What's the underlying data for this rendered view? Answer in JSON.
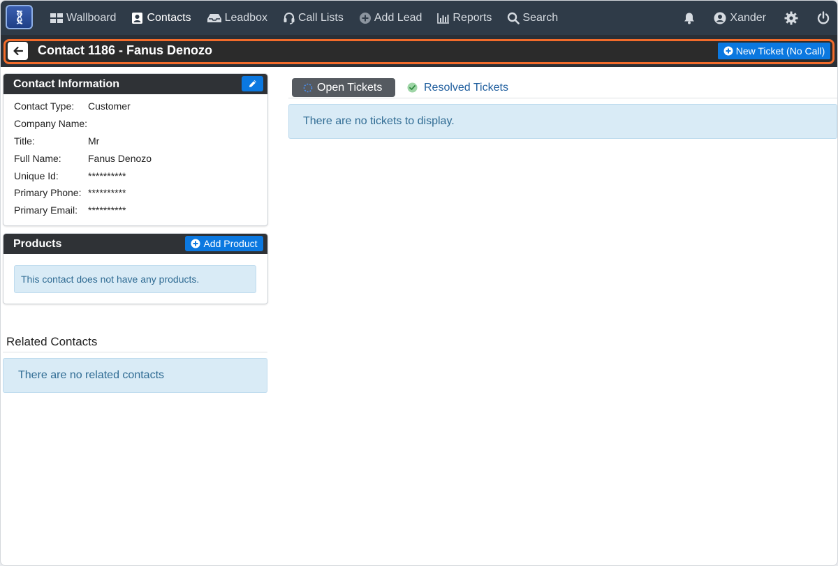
{
  "nav": {
    "items": [
      {
        "label": "Wallboard",
        "icon": "grid-icon"
      },
      {
        "label": "Contacts",
        "icon": "contact-card-icon"
      },
      {
        "label": "Leadbox",
        "icon": "inbox-icon"
      },
      {
        "label": "Call Lists",
        "icon": "headset-icon"
      },
      {
        "label": "Add Lead",
        "icon": "plus-circle-icon"
      },
      {
        "label": "Reports",
        "icon": "bar-chart-icon"
      },
      {
        "label": "Search",
        "icon": "search-icon"
      }
    ],
    "user": "Xander"
  },
  "header": {
    "title": "Contact 1186 - Fanus Denozo",
    "new_ticket_label": "New Ticket (No Call)"
  },
  "contact_info": {
    "title": "Contact Information",
    "rows": [
      {
        "label": "Contact Type:",
        "value": "Customer"
      },
      {
        "label": "Company Name:",
        "value": ""
      },
      {
        "label": "Title:",
        "value": "Mr"
      },
      {
        "label": "Full Name:",
        "value": "Fanus Denozo"
      },
      {
        "label": "Unique Id:",
        "value": "**********"
      },
      {
        "label": "Primary Phone:",
        "value": "**********"
      },
      {
        "label": "Primary Email:",
        "value": "**********"
      }
    ]
  },
  "products": {
    "title": "Products",
    "add_label": "Add Product",
    "empty_message": "This contact does not have any products."
  },
  "related": {
    "title": "Related Contacts",
    "empty_message": "There are no related contacts"
  },
  "tickets": {
    "tab_open": "Open Tickets",
    "tab_resolved": "Resolved Tickets",
    "empty_message": "There are no tickets to display."
  },
  "colors": {
    "accent": "#0b78e0",
    "navbar": "#2f3b48",
    "highlight": "#f26b2a",
    "alert_bg": "#d9ebf6"
  }
}
